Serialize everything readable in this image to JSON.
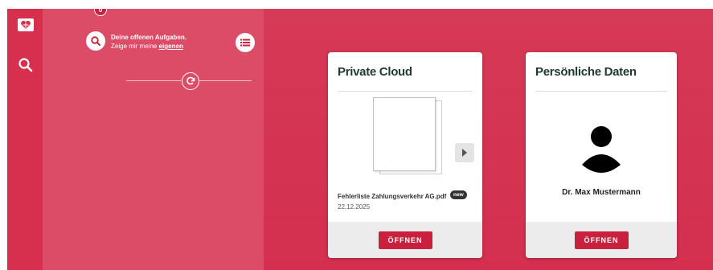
{
  "tasks": {
    "count": "0",
    "line1": "Deine offenen Aufgaben.",
    "line2_prefix": "Zeige mir meine",
    "line2_link": "eigenen"
  },
  "cloud_card": {
    "title": "Private Cloud",
    "file_name": "Fehlerliste Zahlungsverkehr AG.pdf",
    "badge": "new",
    "date": "22.12.2025",
    "open_label": "ÖFFNEN"
  },
  "personal_card": {
    "title": "Persönliche Daten",
    "name": "Dr. Max Mustermann",
    "open_label": "ÖFFNEN"
  },
  "colors": {
    "brand": "#d7304f",
    "panel": "#dd4c66",
    "button": "#c8203d",
    "title_text": "#1f3a2e"
  }
}
